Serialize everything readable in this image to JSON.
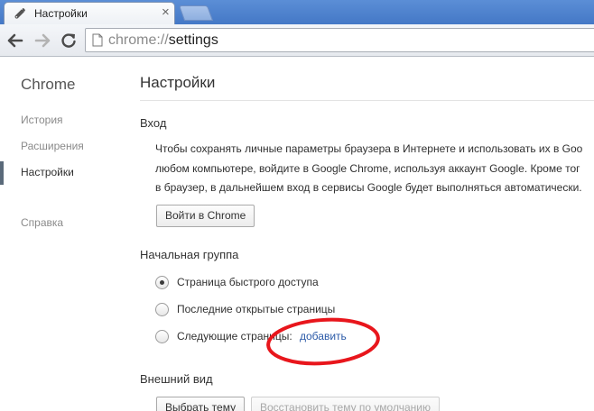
{
  "tab": {
    "title": "Настройки",
    "close": "×"
  },
  "address": {
    "scheme": "chrome://",
    "host": "settings"
  },
  "sidebar": {
    "brand": "Chrome",
    "items": [
      {
        "label": "История"
      },
      {
        "label": "Расширения"
      },
      {
        "label": "Настройки",
        "active": true
      },
      {
        "label": "Справка"
      }
    ]
  },
  "main": {
    "title": "Настройки",
    "signin": {
      "title": "Вход",
      "lines": [
        "Чтобы сохранять личные параметры браузера в Интернете и использовать их в Goo",
        "любом компьютере, войдите в Google Chrome, используя аккаунт Google. Кроме тог",
        "в браузер, в дальнейшем вход в сервисы Google будет выполняться автоматически."
      ],
      "button": "Войти в Chrome"
    },
    "startup": {
      "title": "Начальная группа",
      "options": [
        {
          "label": "Страница быстрого доступа",
          "checked": true
        },
        {
          "label": "Последние открытые страницы",
          "checked": false
        },
        {
          "label": "Следующие страницы:",
          "checked": false
        }
      ],
      "add_link": "добавить"
    },
    "appearance": {
      "title": "Внешний вид",
      "theme_button": "Выбрать тему",
      "reset_button": "Восстановить тему по умолчанию"
    }
  },
  "colors": {
    "link": "#2b5aa8",
    "annotation": "#e8161c",
    "tabstrip": "#4f84d0"
  }
}
